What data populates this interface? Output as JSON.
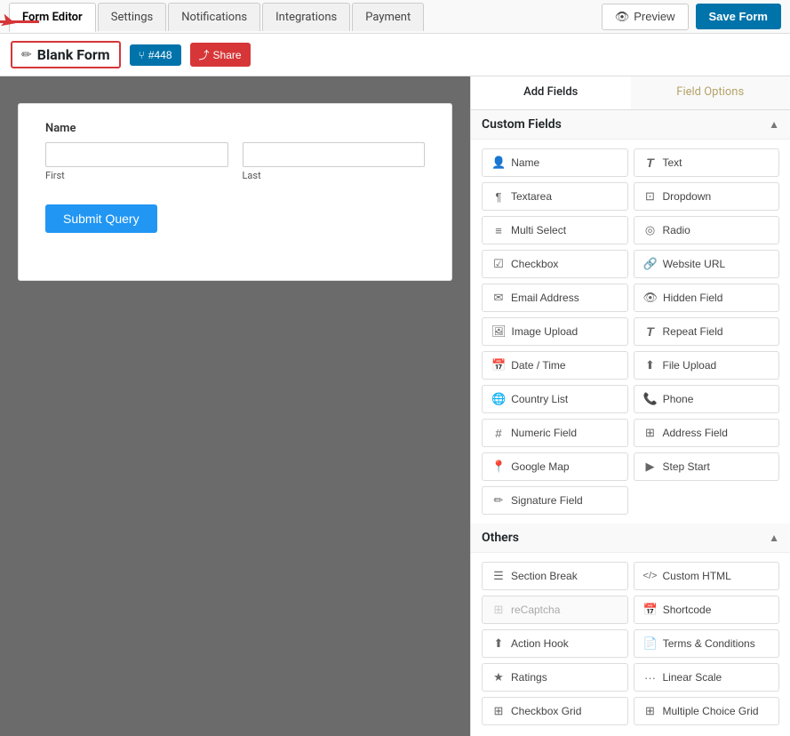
{
  "topNav": {
    "tabs": [
      {
        "id": "form-editor",
        "label": "Form Editor",
        "active": true
      },
      {
        "id": "settings",
        "label": "Settings",
        "active": false
      },
      {
        "id": "notifications",
        "label": "Notifications",
        "active": false
      },
      {
        "id": "integrations",
        "label": "Integrations",
        "active": false
      },
      {
        "id": "payment",
        "label": "Payment",
        "active": false
      }
    ],
    "previewLabel": "Preview",
    "saveLabel": "Save Form"
  },
  "formTitleBar": {
    "editIconSymbol": "✏",
    "formTitle": "Blank Form",
    "counterLabel": "#448",
    "shareLabel": "Share"
  },
  "canvas": {
    "fieldLabel": "Name",
    "firstPlaceholder": "",
    "lastPlaceholder": "",
    "firstSubLabel": "First",
    "lastSubLabel": "Last",
    "submitLabel": "Submit Query"
  },
  "rightPanel": {
    "tabs": [
      {
        "id": "add-fields",
        "label": "Add Fields",
        "active": true
      },
      {
        "id": "field-options",
        "label": "Field Options",
        "active": false
      }
    ],
    "customFields": {
      "sectionLabel": "Custom Fields",
      "fields": [
        {
          "id": "name",
          "icon": "👤",
          "label": "Name",
          "disabled": false
        },
        {
          "id": "text",
          "icon": "T",
          "label": "Text",
          "disabled": false
        },
        {
          "id": "textarea",
          "icon": "¶",
          "label": "Textarea",
          "disabled": false
        },
        {
          "id": "dropdown",
          "icon": "⊞",
          "label": "Dropdown",
          "disabled": false
        },
        {
          "id": "multi-select",
          "icon": "≡",
          "label": "Multi Select",
          "disabled": false
        },
        {
          "id": "radio",
          "icon": "◎",
          "label": "Radio",
          "disabled": false
        },
        {
          "id": "checkbox",
          "icon": "☑",
          "label": "Checkbox",
          "disabled": false
        },
        {
          "id": "website-url",
          "icon": "🔗",
          "label": "Website URL",
          "disabled": false
        },
        {
          "id": "email-address",
          "icon": "✉",
          "label": "Email Address",
          "disabled": false
        },
        {
          "id": "hidden-field",
          "icon": "👁",
          "label": "Hidden Field",
          "disabled": false
        },
        {
          "id": "image-upload",
          "icon": "🖼",
          "label": "Image Upload",
          "disabled": false
        },
        {
          "id": "repeat-field",
          "icon": "T",
          "label": "Repeat Field",
          "disabled": false
        },
        {
          "id": "date-time",
          "icon": "📅",
          "label": "Date / Time",
          "disabled": false
        },
        {
          "id": "file-upload",
          "icon": "⬆",
          "label": "File Upload",
          "disabled": false
        },
        {
          "id": "country-list",
          "icon": "🌐",
          "label": "Country List",
          "disabled": false
        },
        {
          "id": "phone",
          "icon": "📞",
          "label": "Phone",
          "disabled": false
        },
        {
          "id": "numeric-field",
          "icon": "#",
          "label": "Numeric Field",
          "disabled": false
        },
        {
          "id": "address-field",
          "icon": "⊞",
          "label": "Address Field",
          "disabled": false
        },
        {
          "id": "google-map",
          "icon": "📍",
          "label": "Google Map",
          "disabled": false
        },
        {
          "id": "step-start",
          "icon": "▶",
          "label": "Step Start",
          "disabled": false
        },
        {
          "id": "signature-field",
          "icon": "✏",
          "label": "Signature Field",
          "disabled": false
        }
      ]
    },
    "others": {
      "sectionLabel": "Others",
      "fields": [
        {
          "id": "section-break",
          "icon": "☰",
          "label": "Section Break",
          "disabled": false
        },
        {
          "id": "custom-html",
          "icon": "</>",
          "label": "Custom HTML",
          "disabled": false
        },
        {
          "id": "recaptcha",
          "icon": "⊞",
          "label": "reCaptcha",
          "disabled": true
        },
        {
          "id": "shortcode",
          "icon": "📅",
          "label": "Shortcode",
          "disabled": false
        },
        {
          "id": "action-hook",
          "icon": "⬆",
          "label": "Action Hook",
          "disabled": false
        },
        {
          "id": "terms-conditions",
          "icon": "📄",
          "label": "Terms & Conditions",
          "disabled": false
        },
        {
          "id": "ratings",
          "icon": "★",
          "label": "Ratings",
          "disabled": false
        },
        {
          "id": "linear-scale",
          "icon": "···",
          "label": "Linear Scale",
          "disabled": false
        },
        {
          "id": "checkbox-grid",
          "icon": "⊞",
          "label": "Checkbox Grid",
          "disabled": false
        },
        {
          "id": "multiple-choice-grid",
          "icon": "⊞",
          "label": "Multiple Choice Grid",
          "disabled": false
        }
      ]
    }
  }
}
